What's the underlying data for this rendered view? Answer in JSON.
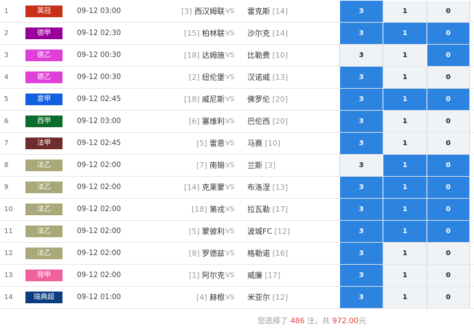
{
  "vs_label": "VS",
  "options": [
    "3",
    "1",
    "0"
  ],
  "matches": [
    {
      "num": "1",
      "league": "英冠",
      "league_color": "#c8301a",
      "time": "09-12 03:00",
      "home_rank": "[3]",
      "home": "西汉姆联",
      "away": "雷克斯",
      "away_rank": "[14]",
      "selected": [
        true,
        false,
        false
      ]
    },
    {
      "num": "2",
      "league": "德甲",
      "league_color": "#990099",
      "time": "09-12 02:30",
      "home_rank": "[15]",
      "home": "柏林联",
      "away": "沙尔克",
      "away_rank": "[14]",
      "selected": [
        true,
        true,
        true
      ]
    },
    {
      "num": "3",
      "league": "德乙",
      "league_color": "#e040d8",
      "time": "09-12 00:30",
      "home_rank": "[18]",
      "home": "达姆施",
      "away": "比勒费",
      "away_rank": "[10]",
      "selected": [
        false,
        false,
        true
      ]
    },
    {
      "num": "4",
      "league": "德乙",
      "league_color": "#e040d8",
      "time": "09-12 00:30",
      "home_rank": "[2]",
      "home": "纽伦堡",
      "away": "汉诺威",
      "away_rank": "[13]",
      "selected": [
        true,
        false,
        false
      ]
    },
    {
      "num": "5",
      "league": "意甲",
      "league_color": "#1060e0",
      "time": "09-12 02:45",
      "home_rank": "[18]",
      "home": "威尼斯",
      "away": "佛罗伦",
      "away_rank": "[20]",
      "selected": [
        true,
        true,
        true
      ]
    },
    {
      "num": "6",
      "league": "西甲",
      "league_color": "#0c6c2a",
      "time": "09-12 03:00",
      "home_rank": "[6]",
      "home": "塞维利",
      "away": "巴伦西",
      "away_rank": "[20]",
      "selected": [
        true,
        false,
        false
      ]
    },
    {
      "num": "7",
      "league": "法甲",
      "league_color": "#6e2c2c",
      "time": "09-12 02:45",
      "home_rank": "[5]",
      "home": "雷恩",
      "away": "马赛",
      "away_rank": "[10]",
      "selected": [
        true,
        false,
        false
      ]
    },
    {
      "num": "8",
      "league": "法乙",
      "league_color": "#a8a878",
      "time": "09-12 02:00",
      "home_rank": "[7]",
      "home": "南锡",
      "away": "兰斯",
      "away_rank": "[3]",
      "selected": [
        false,
        true,
        true
      ]
    },
    {
      "num": "9",
      "league": "法乙",
      "league_color": "#a8a878",
      "time": "09-12 02:00",
      "home_rank": "[14]",
      "home": "克莱蒙",
      "away": "布洛涅",
      "away_rank": "[13]",
      "selected": [
        true,
        true,
        true
      ]
    },
    {
      "num": "10",
      "league": "法乙",
      "league_color": "#a8a878",
      "time": "09-12 02:00",
      "home_rank": "[18]",
      "home": "第戎",
      "away": "拉瓦勒",
      "away_rank": "[17]",
      "selected": [
        true,
        true,
        true
      ]
    },
    {
      "num": "11",
      "league": "法乙",
      "league_color": "#a8a878",
      "time": "09-12 02:00",
      "home_rank": "[5]",
      "home": "蒙彼利",
      "away": "波城FC",
      "away_rank": "[12]",
      "selected": [
        true,
        true,
        true
      ]
    },
    {
      "num": "12",
      "league": "法乙",
      "league_color": "#a8a878",
      "time": "09-12 02:00",
      "home_rank": "[8]",
      "home": "罗德兹",
      "away": "格勒诺",
      "away_rank": "[16]",
      "selected": [
        true,
        false,
        false
      ]
    },
    {
      "num": "13",
      "league": "荷甲",
      "league_color": "#f0609a",
      "time": "09-12 02:00",
      "home_rank": "[1]",
      "home": "阿尔克",
      "away": "威廉",
      "away_rank": "[17]",
      "selected": [
        true,
        false,
        false
      ]
    },
    {
      "num": "14",
      "league": "瑞典超",
      "league_color": "#0c3c80",
      "time": "09-12 01:00",
      "home_rank": "[4]",
      "home": "赫根",
      "away": "米亚尔",
      "away_rank": "[12]",
      "selected": [
        true,
        false,
        false
      ]
    }
  ],
  "footer": {
    "prefix": "您选择了",
    "bets": "486",
    "mid": "注，共",
    "amount": "972.00",
    "suffix": "元"
  },
  "colors": {
    "selected": "#2d83e0",
    "unselected": "#f0f3f6",
    "highlight": "#e0453a"
  }
}
